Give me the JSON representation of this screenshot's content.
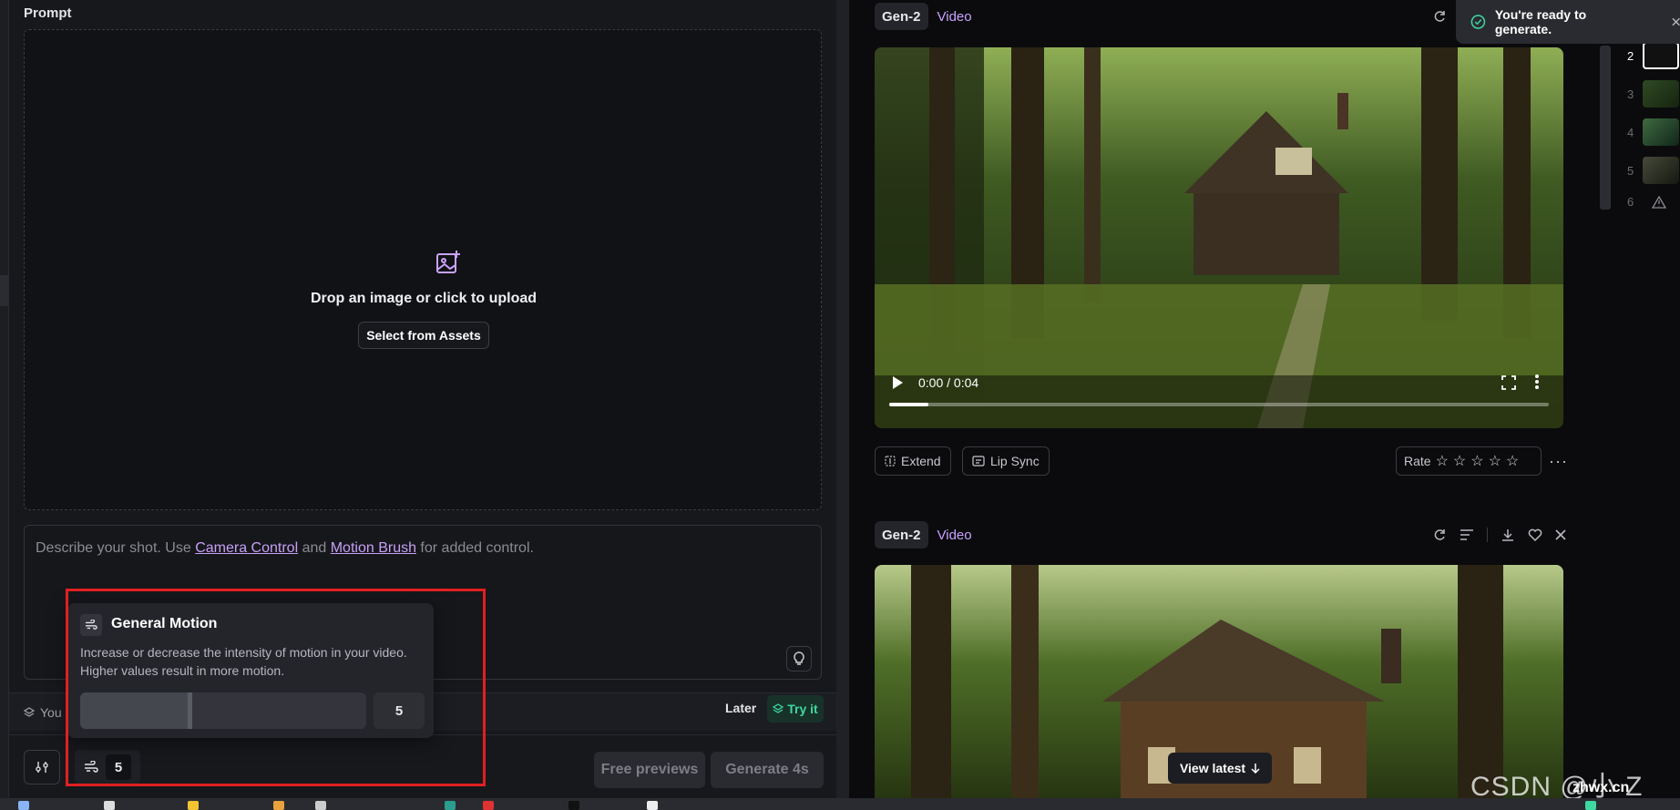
{
  "prompt": {
    "label": "Prompt",
    "drop_text": "Drop an image or click to upload",
    "select_assets": "Select from Assets",
    "placeholder_pre": "Describe your shot. Use ",
    "camera_control": "Camera Control",
    "and_text": " and ",
    "motion_brush": "Motion Brush",
    "placeholder_post": " for added control."
  },
  "info_bar": {
    "text": "You",
    "later": "Later",
    "try_it": "Try it"
  },
  "motion_popover": {
    "title": "General Motion",
    "description": "Increase or decrease the intensity of motion in your video. Higher values result in more motion.",
    "value": "5",
    "max": 10
  },
  "bottom": {
    "motion_value": "5",
    "free_previews": "Free previews",
    "generate": "Generate 4s"
  },
  "toast": {
    "text": "You're ready to generate."
  },
  "cards": [
    {
      "model": "Gen-2",
      "type": "Video",
      "time": "0:00 / 0:04",
      "progress": 0.06,
      "extend": "Extend",
      "lip_sync": "Lip Sync",
      "rate": "Rate"
    },
    {
      "model": "Gen-2",
      "type": "Video"
    }
  ],
  "view_latest": "View latest",
  "rail": [
    "2",
    "3",
    "4",
    "5",
    "6"
  ],
  "watermark": {
    "main": "CSDN @小 Z",
    "small": "zhwx.cn"
  },
  "colors": {
    "accent_purple": "#c9a2ff",
    "try_green": "#3fd8a0",
    "highlight_red": "#e02020"
  }
}
